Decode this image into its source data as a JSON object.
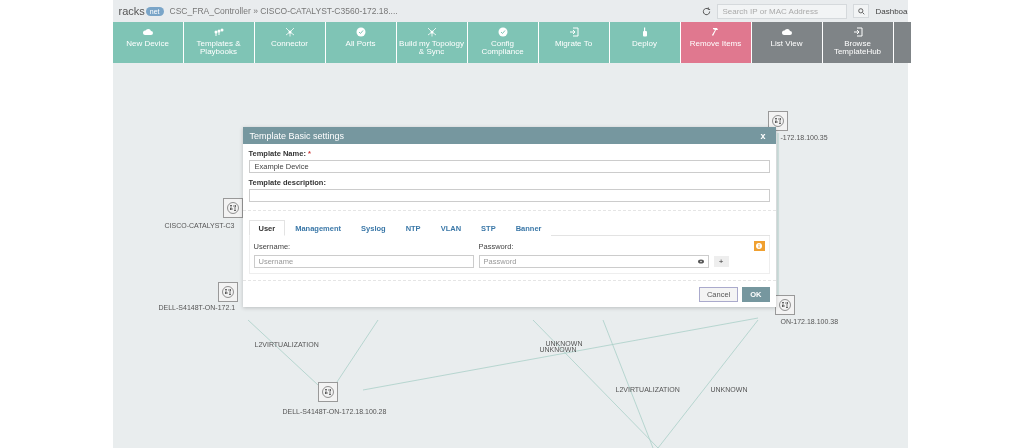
{
  "header": {
    "logo_text": "racks",
    "logo_badge": "net",
    "breadcrumb": "CSC_FRA_Controller » CISCO-CATALYST-C3560-172.18....",
    "search": {
      "placeholder": "Search IP or MAC Address"
    },
    "dashboard_link": "Dashboa"
  },
  "toolbar": [
    {
      "label": "New Device",
      "kind": "action"
    },
    {
      "label": "Templates & Playbooks",
      "kind": "action"
    },
    {
      "label": "Connector",
      "kind": "action"
    },
    {
      "label": "All Ports",
      "kind": "action"
    },
    {
      "label": "Build my Topology & Sync",
      "kind": "action"
    },
    {
      "label": "Config Compliance",
      "kind": "action"
    },
    {
      "label": "Migrate To",
      "kind": "action"
    },
    {
      "label": "Deploy",
      "kind": "action"
    },
    {
      "label": "Remove Items",
      "kind": "danger"
    },
    {
      "label": "List View",
      "kind": "view"
    },
    {
      "label": "Browse TemplateHub",
      "kind": "view"
    },
    {
      "kind": "view"
    }
  ],
  "topology": {
    "nodes": [
      {
        "label": "-172.18.100.35"
      },
      {
        "label": "CISCO-CATALYST-C3"
      },
      {
        "label": "DELL-S4148T-ON-172.1"
      },
      {
        "label": "ON-172.18.100.38"
      },
      {
        "label": "DELL-S4148T-ON-172.18.100.28"
      }
    ],
    "link_labels": [
      "L2VIRTUALIZATION",
      "UNKNOWN",
      "UNKNOWN",
      "L2VIRTUALIZATION",
      "UNKNOWN"
    ]
  },
  "dialog": {
    "title": "Template Basic settings",
    "close": "x",
    "name_label": "Template Name:",
    "required_mark": "*",
    "name_value": "Example Device",
    "description_label": "Template description:",
    "tabs": [
      {
        "label": "User",
        "selected": true
      },
      {
        "label": "Management",
        "selected": false
      },
      {
        "label": "Syslog",
        "selected": false
      },
      {
        "label": "NTP",
        "selected": false
      },
      {
        "label": "VLAN",
        "selected": false
      },
      {
        "label": "STP",
        "selected": false
      },
      {
        "label": "Banner",
        "selected": false
      }
    ],
    "username_label": "Username:",
    "username_placeholder": "Username",
    "password_label": "Password:",
    "password_placeholder": "Password",
    "add_button": "+",
    "buttons": [
      {
        "label": "Cancel",
        "kind": "secondary"
      },
      {
        "label": "OK",
        "kind": "primary"
      }
    ]
  }
}
